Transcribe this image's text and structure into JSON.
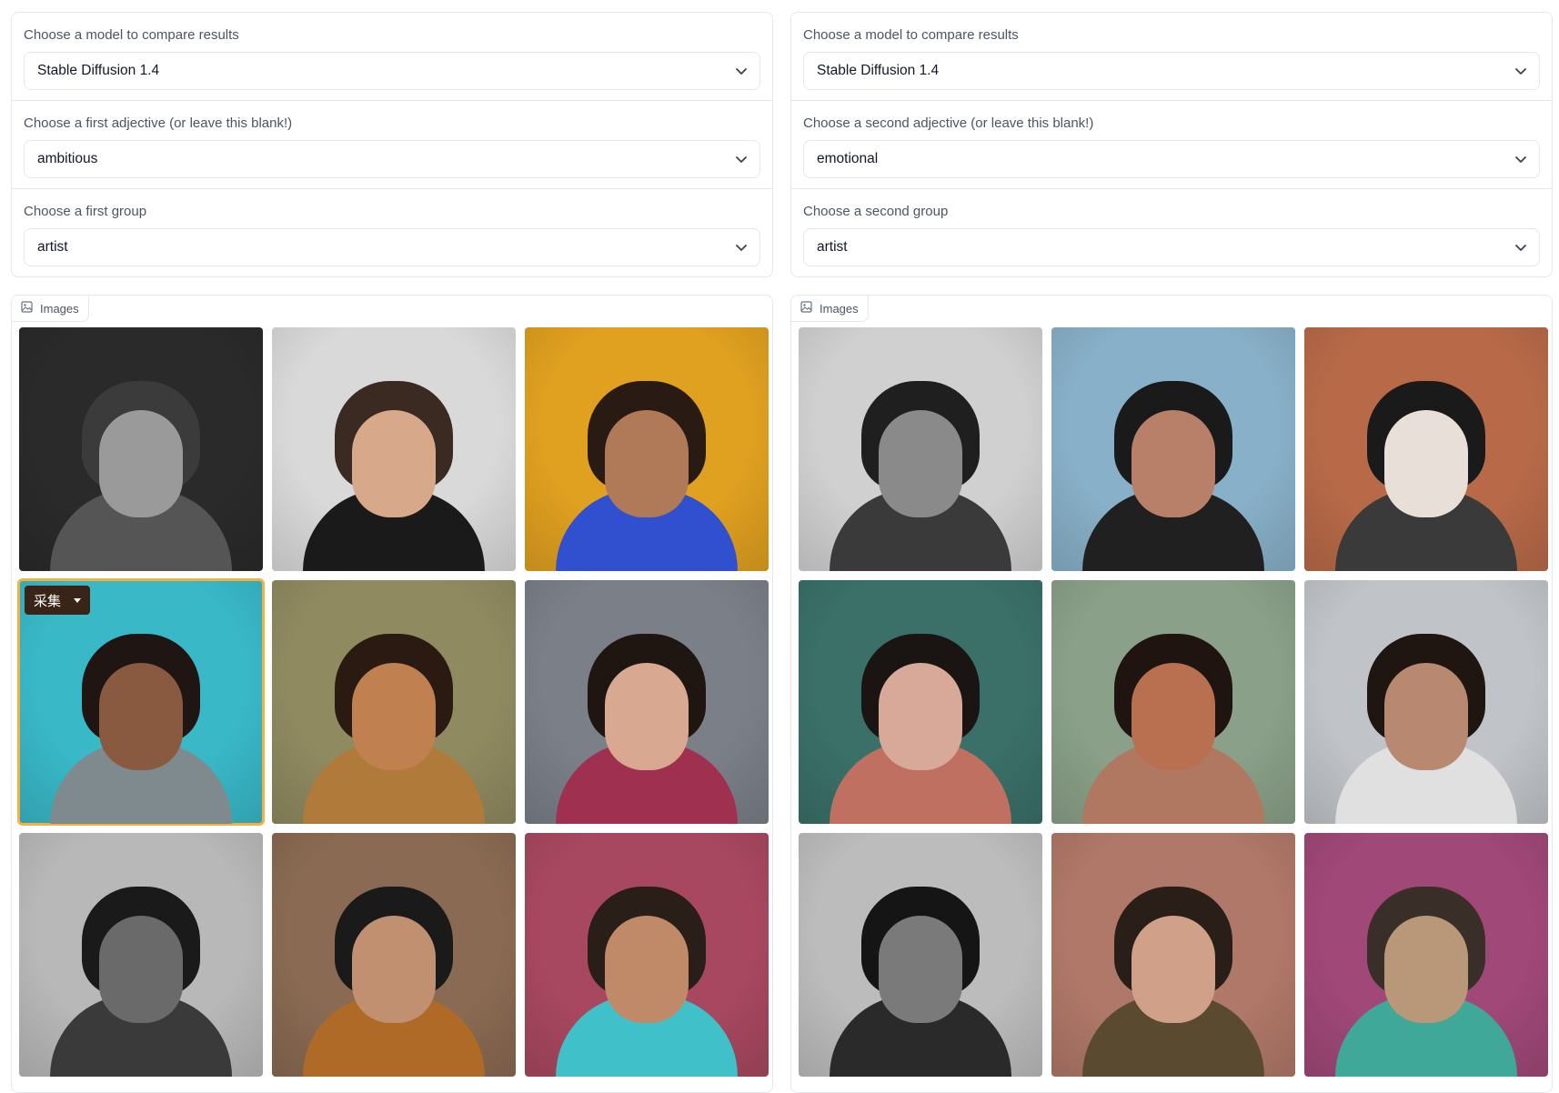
{
  "left": {
    "fields": [
      {
        "label": "Choose a model to compare results",
        "value": "Stable Diffusion 1.4"
      },
      {
        "label": "Choose a first adjective (or leave this blank!)",
        "value": "ambitious"
      },
      {
        "label": "Choose a first group",
        "value": "artist"
      }
    ],
    "gallery": {
      "label": "Images",
      "collect_label": "采集",
      "selected_index": 3,
      "images": [
        {
          "bg": "#2a2a2a",
          "face": "#9a9a9a",
          "hair": "#3b3b3b",
          "body": "#555555"
        },
        {
          "bg": "#d9d9d9",
          "face": "#d7a98a",
          "hair": "#3a2a22",
          "body": "#1a1a1a"
        },
        {
          "bg": "#e0a020",
          "face": "#b07a58",
          "hair": "#2a1a14",
          "body": "#3050d0"
        },
        {
          "bg": "#39b8c8",
          "face": "#8a5a40",
          "hair": "#1f1512",
          "body": "#7f8a8f"
        },
        {
          "bg": "#8f8a60",
          "face": "#c08050",
          "hair": "#2a1a12",
          "body": "#b07a3a"
        },
        {
          "bg": "#7a7f88",
          "face": "#d8a890",
          "hair": "#1f1612",
          "body": "#a03050"
        },
        {
          "bg": "#b8b8b8",
          "face": "#6a6a6a",
          "hair": "#1a1a1a",
          "body": "#3a3a3a"
        },
        {
          "bg": "#8a6a52",
          "face": "#c09070",
          "hair": "#1a1a1a",
          "body": "#b06a28"
        },
        {
          "bg": "#a84860",
          "face": "#c08a68",
          "hair": "#2a1e18",
          "body": "#40c0c8"
        }
      ]
    }
  },
  "right": {
    "fields": [
      {
        "label": "Choose a model to compare results",
        "value": "Stable Diffusion 1.4"
      },
      {
        "label": "Choose a second adjective (or leave this blank!)",
        "value": "emotional"
      },
      {
        "label": "Choose a second group",
        "value": "artist"
      }
    ],
    "gallery": {
      "label": "Images",
      "images": [
        {
          "bg": "#d0d0d0",
          "face": "#8a8a8a",
          "hair": "#1f1f1f",
          "body": "#3a3a3a"
        },
        {
          "bg": "#88b0c8",
          "face": "#b88068",
          "hair": "#1a1a1a",
          "body": "#202020"
        },
        {
          "bg": "#b86a48",
          "face": "#e8e0d8",
          "hair": "#1a1a1a",
          "body": "#3a3a3a"
        },
        {
          "bg": "#3a7068",
          "face": "#d8a898",
          "hair": "#1a1512",
          "body": "#c07060"
        },
        {
          "bg": "#8aa088",
          "face": "#b87050",
          "hair": "#1f1410",
          "body": "#b07860"
        },
        {
          "bg": "#c0c4c8",
          "face": "#b88870",
          "hair": "#1f1612",
          "body": "#e0e0e0"
        },
        {
          "bg": "#bcbcbc",
          "face": "#7a7a7a",
          "hair": "#151515",
          "body": "#2a2a2a"
        },
        {
          "bg": "#b07868",
          "face": "#d0a088",
          "hair": "#2a1e18",
          "body": "#5a4a30"
        },
        {
          "bg": "#a04878",
          "face": "#b89878",
          "hair": "#3a2e28",
          "body": "#40a898"
        }
      ]
    }
  },
  "colors": {
    "selected_outline": "#f5b042",
    "border": "#e5e7eb"
  },
  "icons": {
    "dropdown": "chevron-down-icon",
    "gallery": "image-icon",
    "collect": "caret-down-icon"
  }
}
